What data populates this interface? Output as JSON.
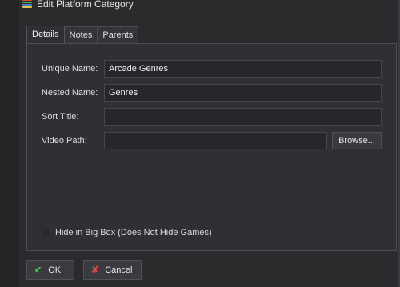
{
  "window": {
    "title": "Edit Platform Category",
    "icon": "platform-stack-icon"
  },
  "tabs": [
    {
      "label": "Details",
      "active": true
    },
    {
      "label": "Notes",
      "active": false
    },
    {
      "label": "Parents",
      "active": false
    }
  ],
  "details": {
    "unique_name_label": "Unique Name:",
    "unique_name_value": "Arcade Genres",
    "nested_name_label": "Nested Name:",
    "nested_name_value": "Genres",
    "sort_title_label": "Sort Title:",
    "sort_title_value": "",
    "video_path_label": "Video Path:",
    "video_path_value": "",
    "browse_label": "Browse...",
    "hide_in_bigbox_label": "Hide in Big Box (Does Not Hide Games)",
    "hide_in_bigbox_checked": false
  },
  "footer": {
    "ok_label": "OK",
    "cancel_label": "Cancel"
  },
  "colors": {
    "ok_icon": "#3fbf4a",
    "cancel_icon": "#e0453a",
    "icon_stripes": [
      "#e0453a",
      "#3fbf4a",
      "#3b82e0",
      "#e8c53a"
    ]
  }
}
